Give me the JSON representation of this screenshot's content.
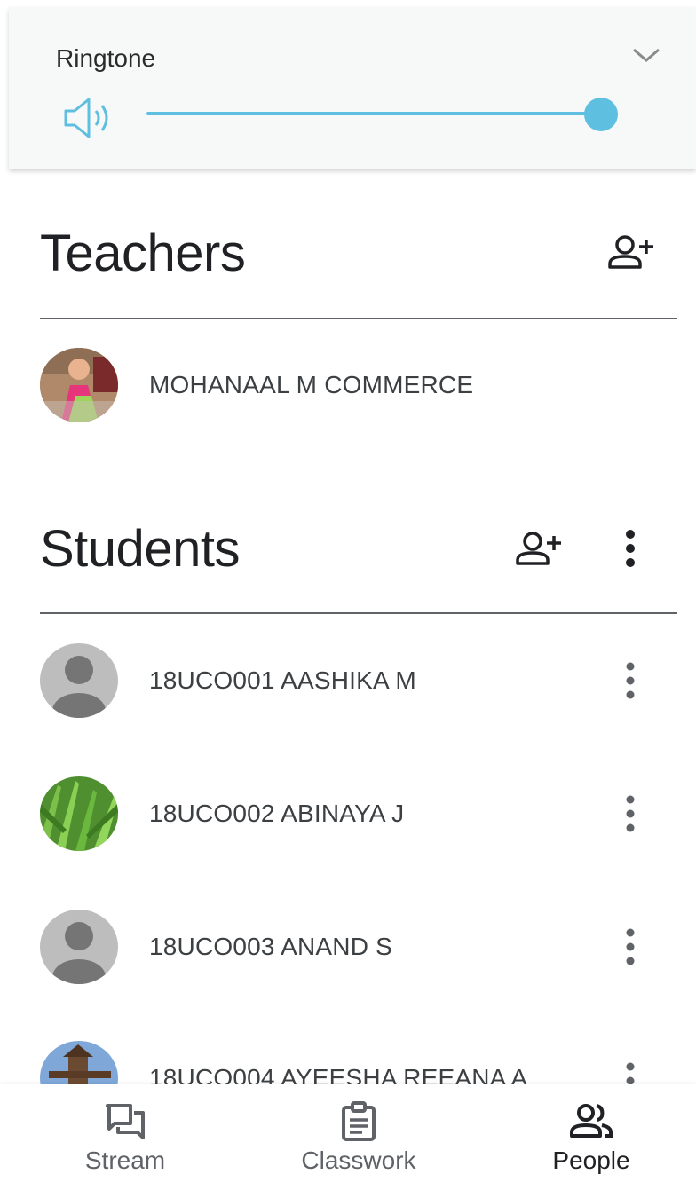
{
  "volume": {
    "label": "Ringtone",
    "level": 1.0,
    "accent_color": "#5fbfe0"
  },
  "teachers": {
    "title": "Teachers",
    "add_icon": "person-add-icon",
    "items": [
      {
        "name": "MOHANAAL M COMMERCE",
        "avatar": "photo-child"
      }
    ]
  },
  "students": {
    "title": "Students",
    "add_icon": "person-add-icon",
    "more_icon": "more-vertical-icon",
    "items": [
      {
        "name": "18UCO001 AASHIKA M",
        "avatar": "generic"
      },
      {
        "name": "18UCO002 ABINAYA J",
        "avatar": "photo-grass"
      },
      {
        "name": "18UCO003 ANAND S",
        "avatar": "generic"
      },
      {
        "name": "18UCO004 AYEESHA REEANA A",
        "avatar": "photo-tower"
      }
    ]
  },
  "bottom_nav": {
    "items": [
      {
        "label": "Stream",
        "icon": "stream-icon",
        "active": false
      },
      {
        "label": "Classwork",
        "icon": "classwork-icon",
        "active": false
      },
      {
        "label": "People",
        "icon": "people-icon",
        "active": true
      }
    ]
  }
}
